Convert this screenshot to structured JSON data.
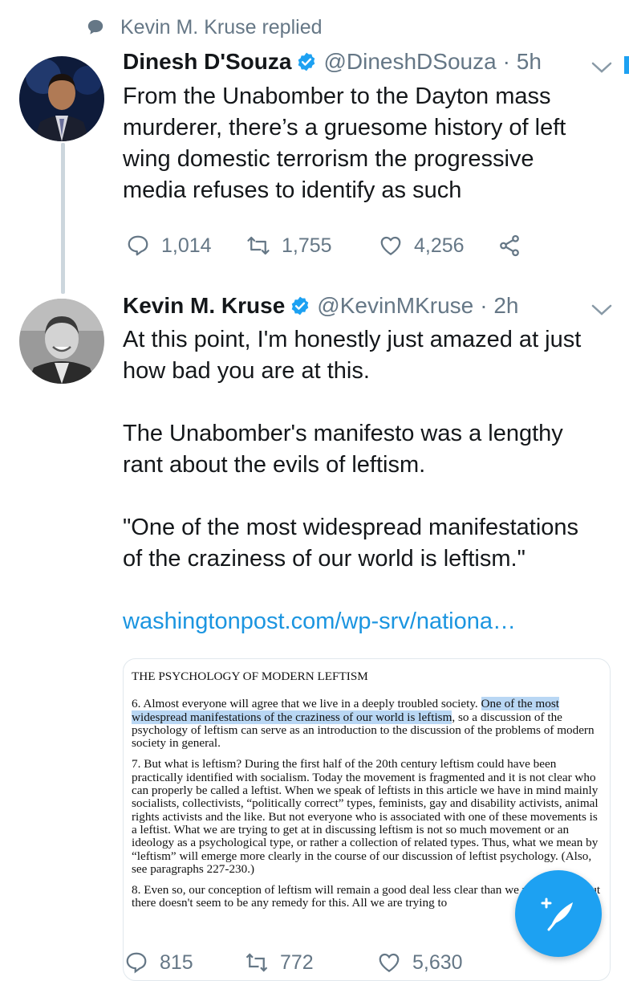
{
  "context": {
    "icon": "speech-bubble-icon",
    "text": "Kevin M. Kruse replied"
  },
  "tweet1": {
    "name": "Dinesh D'Souza",
    "handle": "@DineshDSouza",
    "time": "· 5h",
    "text": "From the Unabomber to the Dayton mass\nmurderer, there’s a gruesome history of left\nwing domestic terrorism the progressive\nmedia refuses to identify as such",
    "replies": "1,014",
    "retweets": "1,755",
    "likes": "4,256"
  },
  "tweet2": {
    "name": "Kevin M. Kruse",
    "handle": "@KevinMKruse",
    "time": "· 2h",
    "text": "At this point, I'm honestly just amazed at just\nhow bad you are at this.\n\nThe Unabomber's manifesto was a lengthy\nrant about the evils of leftism.\n\n\"One of the most widespread manifestations\nof the craziness of our world is leftism.\"",
    "link": "washingtonpost.com/wp-srv/nationa…",
    "replies": "815",
    "retweets": "772",
    "likes": "5,630"
  },
  "document": {
    "title": "THE PSYCHOLOGY OF MODERN LEFTISM",
    "p6_before": "6. Almost everyone will agree that we live in a deeply troubled society. ",
    "p6_highlight": "One of the most widespread manifestations of the craziness of our world is leftism",
    "p6_after": ", so a discussion of the psychology of leftism can serve as an introduction to the discussion of the problems of modern society in general.",
    "p7": "7. But what is leftism? During the first half of the 20th century leftism could have been practically identified with socialism. Today the movement is fragmented and it is not clear who can properly be called a leftist. When we speak of leftists in this article we have in mind mainly socialists, collectivists, “politically correct” types, feminists, gay and disability activists, animal rights activists and the like. But not everyone who is associated with one of these movements is a leftist. What we are trying to get at in discussing leftism is not so much movement or an ideology as a psychological type, or rather a collection of related types. Thus, what we mean by “leftism” will emerge more clearly in the course of our discussion of leftist psychology. (Also, see paragraphs 227-230.)",
    "p8": "8. Even so, our conception of leftism will remain a good deal less clear than we would wish, but there doesn't seem to be any remedy for this. All we are trying to"
  },
  "colors": {
    "accent": "#1da1f2",
    "link": "#1b95e0",
    "muted": "#657786",
    "highlight": "#b9d7f4"
  }
}
